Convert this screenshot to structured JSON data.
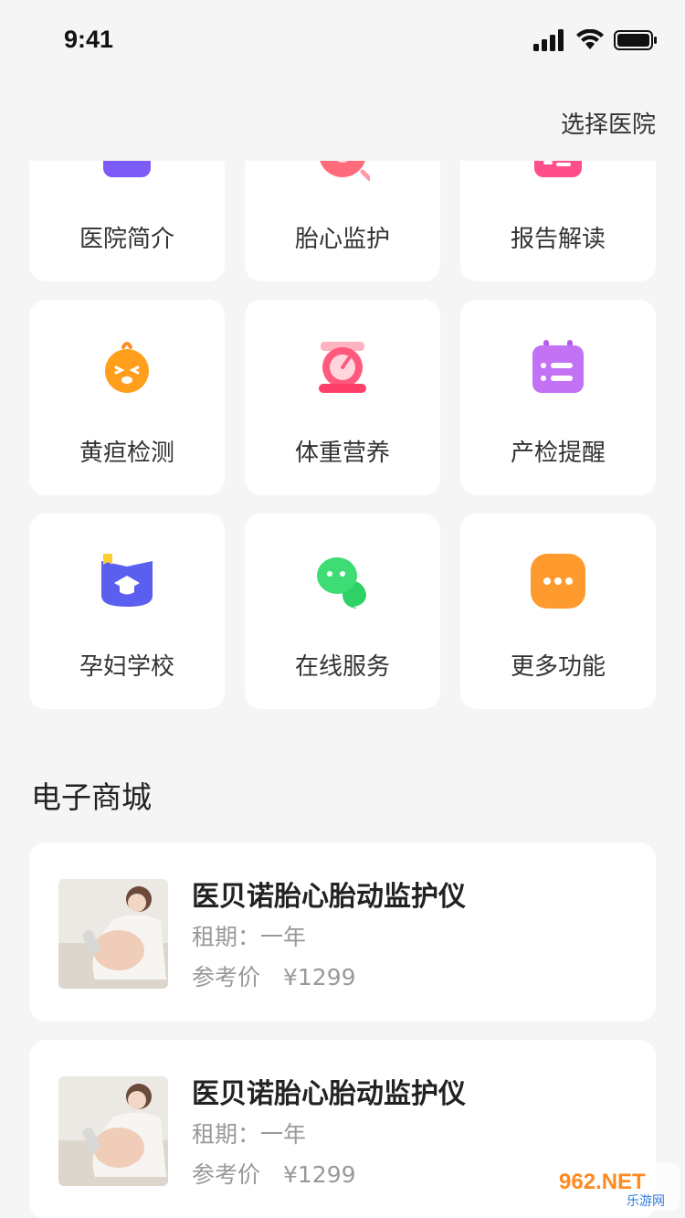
{
  "status_bar": {
    "time": "9:41"
  },
  "header": {
    "select_hospital": "选择医院"
  },
  "grid": {
    "items": [
      {
        "label": "医院简介",
        "icon": "hospital-info-icon"
      },
      {
        "label": "胎心监护",
        "icon": "fetal-heart-icon"
      },
      {
        "label": "报告解读",
        "icon": "report-icon"
      },
      {
        "label": "黄疸检测",
        "icon": "jaundice-icon"
      },
      {
        "label": "体重营养",
        "icon": "scale-icon"
      },
      {
        "label": "产检提醒",
        "icon": "calendar-icon"
      },
      {
        "label": "孕妇学校",
        "icon": "school-icon"
      },
      {
        "label": "在线服务",
        "icon": "chat-icon"
      },
      {
        "label": "更多功能",
        "icon": "more-icon"
      }
    ]
  },
  "mall": {
    "title": "电子商城",
    "products": [
      {
        "name": "医贝诺胎心胎动监护仪",
        "term": "租期：一年",
        "price": "参考价　¥1299"
      },
      {
        "name": "医贝诺胎心胎动监护仪",
        "term": "租期：一年",
        "price": "参考价　¥1299"
      }
    ]
  },
  "watermark": {
    "text": "962.NET",
    "sub": "乐游网"
  }
}
